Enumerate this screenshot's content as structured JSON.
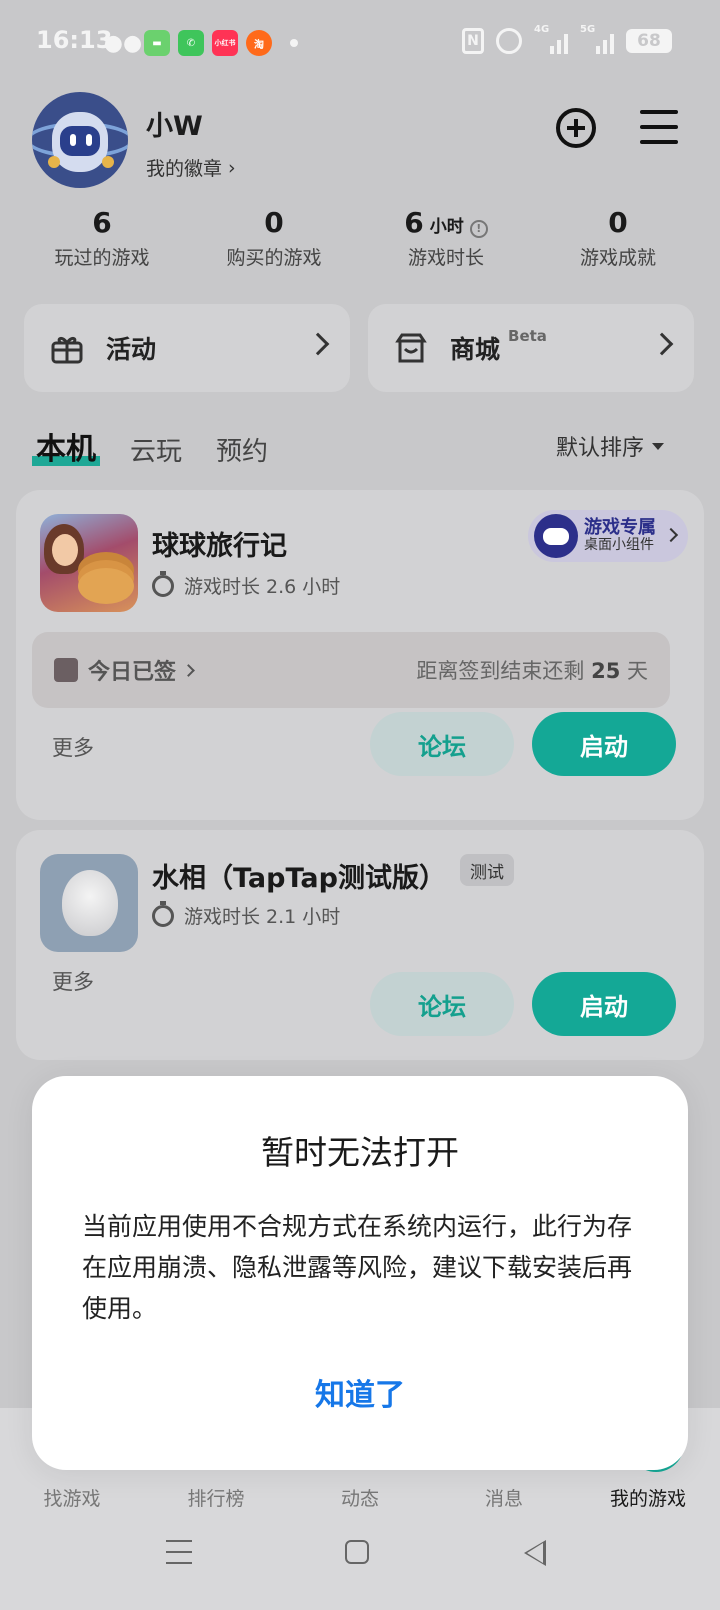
{
  "status_bar": {
    "time": "16:13",
    "notif_icons": [
      "wechat-icon",
      "messages-icon",
      "phone-icon",
      "xiaohongshu-icon",
      "taobao-icon"
    ],
    "xhs_label": "小红书",
    "network_4g": "4G",
    "network_5g": "5G",
    "battery": "68"
  },
  "profile": {
    "username": "小W",
    "badge_link": "我的徽章"
  },
  "stats": [
    {
      "value": "6",
      "unit": "",
      "label": "玩过的游戏"
    },
    {
      "value": "0",
      "unit": "",
      "label": "购买的游戏"
    },
    {
      "value": "6",
      "unit": "小时",
      "label": "游戏时长"
    },
    {
      "value": "0",
      "unit": "",
      "label": "游戏成就"
    }
  ],
  "features": {
    "activity_label": "活动",
    "store_label": "商城",
    "store_badge": "Beta"
  },
  "tabs": {
    "local": "本机",
    "cloud": "云玩",
    "reserve": "预约",
    "sort": "默认排序"
  },
  "games": [
    {
      "title": "球球旅行记",
      "playtime": "游戏时长 2.6 小时",
      "widget_title": "游戏专属",
      "widget_sub": "桌面小组件",
      "checkin_label": "今日已签",
      "checkin_remaining_prefix": "距离签到结束还剩",
      "checkin_days": "25",
      "checkin_suffix": "天",
      "more": "更多",
      "forum": "论坛",
      "launch": "启动"
    },
    {
      "title": "水相（TapTap测试版）",
      "tag": "测试",
      "playtime": "游戏时长 2.1 小时",
      "more": "更多",
      "forum": "论坛",
      "launch": "启动"
    }
  ],
  "dialog": {
    "title": "暂时无法打开",
    "body": "当前应用使用不合规方式在系统内运行，此行为存在应用崩溃、隐私泄露等风险，建议下载安装后再使用。",
    "button": "知道了"
  },
  "bottom_nav": [
    "找游戏",
    "排行榜",
    "动态",
    "消息",
    "我的游戏"
  ],
  "colors": {
    "accent": "#14a896",
    "link_blue": "#1677e8",
    "background": "#c8c8ca"
  }
}
